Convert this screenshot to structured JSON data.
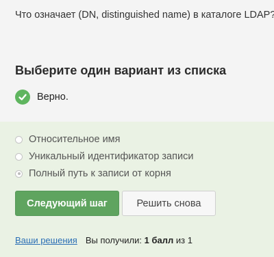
{
  "question": {
    "text": "Что означает (DN, distinguished name) в каталоге LDAP?"
  },
  "heading": "Выберите один вариант из списка",
  "feedback": {
    "icon": "check-icon",
    "text": "Верно.",
    "color": "#5fb55f"
  },
  "options": [
    {
      "label": "Относительное имя",
      "selected": false
    },
    {
      "label": "Уникальный идентификатор записи",
      "selected": false
    },
    {
      "label": "Полный путь к записи от корня",
      "selected": true
    }
  ],
  "buttons": {
    "next_label": "Следующий шаг",
    "retry_label": "Решить снова"
  },
  "footer": {
    "solutions_link": "Ваши решения",
    "score_prefix": "Вы получили:",
    "score_value": "1 балл",
    "score_suffix": "из 1"
  },
  "colors": {
    "accent": "#5fa45f",
    "answer_background": "#eaf2e4",
    "link": "#2a6eb5"
  }
}
